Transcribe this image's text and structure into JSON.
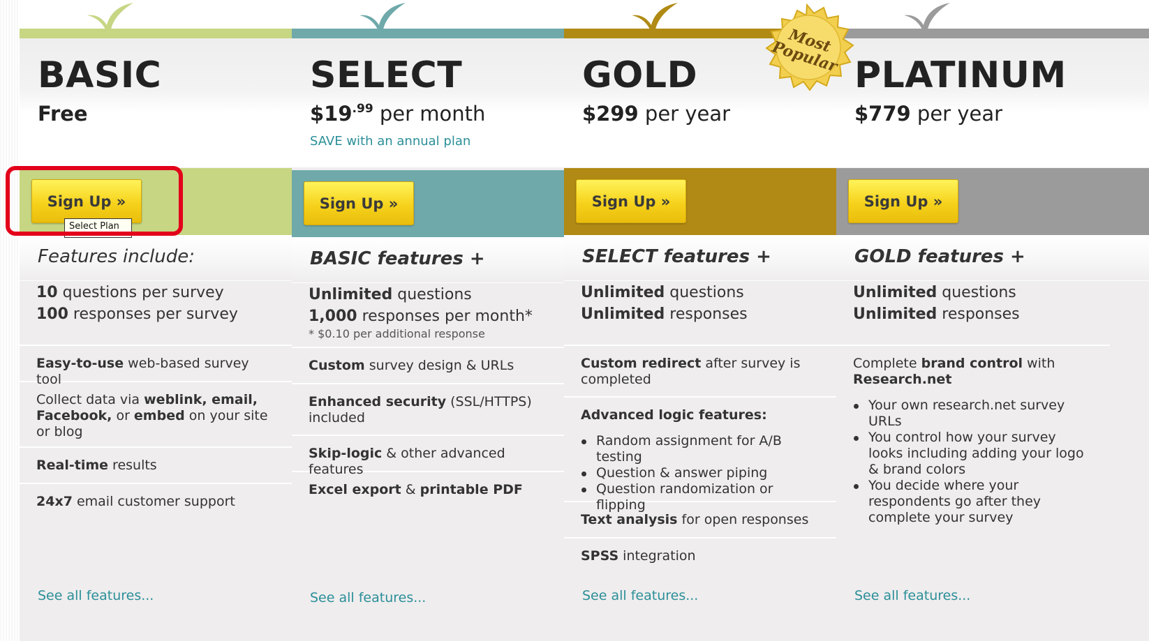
{
  "colors": {
    "basic": "#c6d683",
    "select": "#6fa9aa",
    "gold": "#b08a14",
    "platinum": "#9b9b9b",
    "link": "#2b8f98",
    "highlight": "#e3001b"
  },
  "badge": {
    "line1": "Most",
    "line2": "Popular"
  },
  "tooltip": "Select Plan",
  "plans": [
    {
      "name": "BASIC",
      "price_main": "Free",
      "signup_label": "Sign Up »",
      "features_title": "Features include:",
      "sec1_a_bold": "10",
      "sec1_a": " questions per survey",
      "sec1_b_bold": "100",
      "sec1_b": " responses per survey",
      "f1_bold": "Easy-to-use",
      "f1": " web-based survey tool",
      "f2_pre": "Collect data via ",
      "f2_b1": "weblink, email, Facebook,",
      "f2_mid": " or ",
      "f2_b2": "embed",
      "f2_post": " on your site or blog",
      "f3_bold": "Real-time",
      "f3": " results",
      "f4_bold": "24x7",
      "f4": " email customer support",
      "see_all": "See all features..."
    },
    {
      "name": "SELECT",
      "price_amount": "$19",
      "price_cents": ".99",
      "price_period": " per month",
      "price_note": "SAVE with an annual plan",
      "signup_label": "Sign Up »",
      "features_title": "BASIC features +",
      "sec1_a_bold": "Unlimited",
      "sec1_a": " questions",
      "sec1_b_bold": "1,000",
      "sec1_b": " responses per month*",
      "sec1_note": "* $0.10 per additional response",
      "f1_bold": "Custom",
      "f1": " survey design & URLs",
      "f2_bold": "Enhanced security",
      "f2": " (SSL/HTTPS) included",
      "f3_bold": "Skip-logic",
      "f3": " & other advanced features",
      "f4_b1": "Excel export",
      "f4_mid": " & ",
      "f4_b2": "printable PDF",
      "see_all": "See all features..."
    },
    {
      "name": "GOLD",
      "price_amount": "$299",
      "price_period": " per year",
      "signup_label": "Sign Up »",
      "features_title": "SELECT features +",
      "sec1_a_bold": "Unlimited",
      "sec1_a": " questions",
      "sec1_b_bold": "Unlimited",
      "sec1_b": " responses",
      "f1_bold": "Custom redirect",
      "f1": " after survey is completed",
      "f2_bold": "Advanced logic features:",
      "f2_items": [
        "Random assignment for A/B testing",
        "Question & answer piping",
        "Question randomization or flipping"
      ],
      "f3_bold": "Text analysis",
      "f3": " for open responses",
      "f4_bold": "SPSS",
      "f4": " integration",
      "see_all": "See all features..."
    },
    {
      "name": "PLATINUM",
      "price_amount": "$779",
      "price_period": " per year",
      "signup_label": "Sign Up »",
      "features_title": "GOLD features +",
      "sec1_a_bold": "Unlimited",
      "sec1_a": " questions",
      "sec1_b_bold": "Unlimited",
      "sec1_b": " responses",
      "f1_pre": "Complete ",
      "f1_bold": "brand control",
      "f1_mid": " with ",
      "f1_bold2": "Research.net",
      "f1_items": [
        "Your own research.net survey URLs",
        "You control how your survey looks including adding your logo & brand colors",
        "You decide where your respondents go after they complete your survey"
      ],
      "see_all": "See all features..."
    }
  ]
}
